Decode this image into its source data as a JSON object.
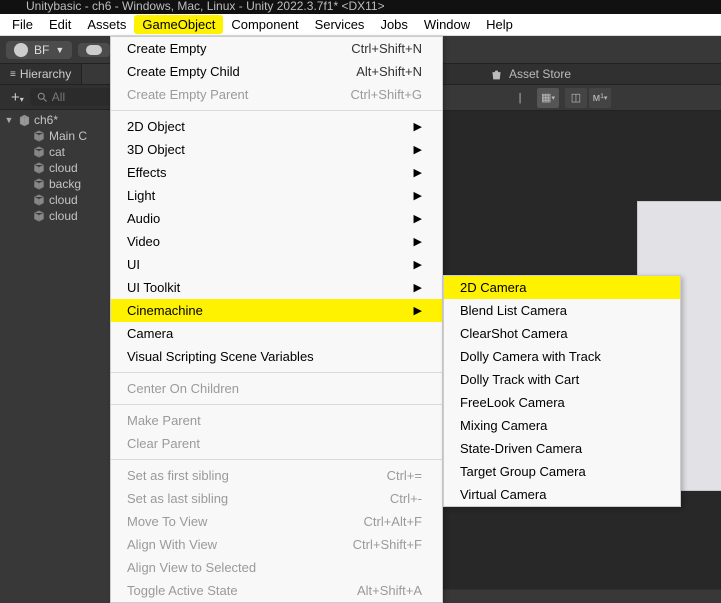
{
  "titlebar": "Unitybasic - ch6 - Windows, Mac, Linux - Unity 2022.3.7f1* <DX11>",
  "menubar": {
    "items": [
      "File",
      "Edit",
      "Assets",
      "GameObject",
      "Component",
      "Services",
      "Jobs",
      "Window",
      "Help"
    ],
    "highlighted": "GameObject"
  },
  "toolbar": {
    "account": "BF"
  },
  "hierarchy": {
    "tab": "Hierarchy",
    "search_placeholder": "All",
    "root": "ch6*",
    "items": [
      "Main C",
      "cat",
      "cloud",
      "backg",
      "cloud",
      "cloud"
    ]
  },
  "asset_tab": "Asset Store",
  "primary_menu": [
    {
      "label": "Create Empty",
      "shortcut": "Ctrl+Shift+N"
    },
    {
      "label": "Create Empty Child",
      "shortcut": "Alt+Shift+N"
    },
    {
      "label": "Create Empty Parent",
      "shortcut": "Ctrl+Shift+G",
      "disabled": true
    },
    {
      "sep": true
    },
    {
      "label": "2D Object",
      "sub": true
    },
    {
      "label": "3D Object",
      "sub": true
    },
    {
      "label": "Effects",
      "sub": true
    },
    {
      "label": "Light",
      "sub": true
    },
    {
      "label": "Audio",
      "sub": true
    },
    {
      "label": "Video",
      "sub": true
    },
    {
      "label": "UI",
      "sub": true
    },
    {
      "label": "UI Toolkit",
      "sub": true
    },
    {
      "label": "Cinemachine",
      "sub": true,
      "hl": true
    },
    {
      "label": "Camera"
    },
    {
      "label": "Visual Scripting Scene Variables"
    },
    {
      "sep": true
    },
    {
      "label": "Center On Children",
      "disabled": true
    },
    {
      "sep": true
    },
    {
      "label": "Make Parent",
      "disabled": true
    },
    {
      "label": "Clear Parent",
      "disabled": true
    },
    {
      "sep": true
    },
    {
      "label": "Set as first sibling",
      "shortcut": "Ctrl+=",
      "disabled": true
    },
    {
      "label": "Set as last sibling",
      "shortcut": "Ctrl+-",
      "disabled": true
    },
    {
      "label": "Move To View",
      "shortcut": "Ctrl+Alt+F",
      "disabled": true
    },
    {
      "label": "Align With View",
      "shortcut": "Ctrl+Shift+F",
      "disabled": true
    },
    {
      "label": "Align View to Selected",
      "disabled": true
    },
    {
      "label": "Toggle Active State",
      "shortcut": "Alt+Shift+A",
      "disabled": true
    }
  ],
  "secondary_menu": [
    {
      "label": "2D Camera",
      "hl": true
    },
    {
      "label": "Blend List Camera"
    },
    {
      "label": "ClearShot Camera"
    },
    {
      "label": "Dolly Camera with Track"
    },
    {
      "label": "Dolly Track with Cart"
    },
    {
      "label": "FreeLook Camera"
    },
    {
      "label": "Mixing Camera"
    },
    {
      "label": "State-Driven Camera"
    },
    {
      "label": "Target Group Camera"
    },
    {
      "label": "Virtual Camera"
    }
  ]
}
